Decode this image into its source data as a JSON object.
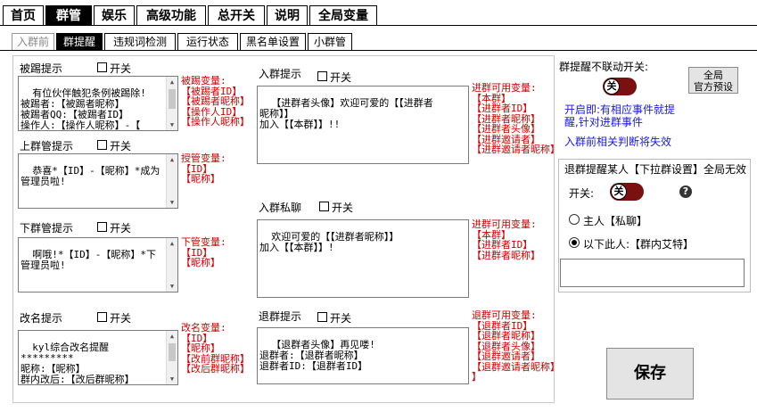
{
  "top_tabs": [
    "首页",
    "群管",
    "娱乐",
    "高级功能",
    "总开关",
    "说明",
    "全局变量"
  ],
  "sub_tabs": [
    "入群前",
    "群提醒",
    "违规词检测",
    "运行状态",
    "黑名单设置",
    "小群管"
  ],
  "checkbox_label": "开关",
  "kick": {
    "title": "被踢提示",
    "text": "有位伙伴触犯条例被踢除!\n被踢者:【被踢者昵称】\n被踢者QQ:【被踢者ID】\n操作人:【操作人昵称】-【\n操作人ID】",
    "vars": "被踢变量:\n【被踢者ID】\n【被踢者昵称】\n【操作人ID】\n【操作人昵称】"
  },
  "promote": {
    "title": "上群管提示",
    "text": "恭喜*【ID】-【昵称】*成为\n管理员啦!",
    "vars": "授管变量:\n【ID】\n【昵称】"
  },
  "demote": {
    "title": "下群管提示",
    "text": "啊哦!*【ID】-【昵称】*下\n管理员啦!",
    "vars": "下管变量:\n【ID】\n【昵称】"
  },
  "rename": {
    "title": "改名提示",
    "text": "kyl综合改名提醒\n*********\n昵称:【昵称】\n群内改后:【改后群昵称】\n群内改前:【改前群昵称】",
    "vars": "改名变量:\n【ID】\n【昵称】\n【改前群昵称】\n【改后群昵称】"
  },
  "join": {
    "title": "入群提示",
    "text": "【进群者头像】欢迎可爱的【【进群者\n昵称】】\n加入【【本群】】!!",
    "vars": "进群可用变量:\n【本群】\n【进群者ID】\n【进群者昵称】\n【进群者头像】\n【进群邀请者】\n【进群邀请者昵称】"
  },
  "join_private": {
    "title": "入群私聊",
    "text": "欢迎可爱的【【进群者昵称】】\n加入【【本群】】!",
    "vars": "进群可用变量:\n【本群】\n【进群者ID】\n【进群者昵称】"
  },
  "leave": {
    "title": "退群提示",
    "text": "【退群者头像】再见喽!\n退群者:【退群者昵称】\n退群者ID:【退群者ID】",
    "vars": "退群可用变量:\n【退群者ID】\n【退群者昵称】\n【退群者头像】\n【退群邀请者】\n【退群邀请者昵称】\n】"
  },
  "right": {
    "no_link_label": "群提醒不联动开关:",
    "toggle_text": "关",
    "preset_button": "全局\n官方预设",
    "desc1": "开启即:有相应事件就提\n醒,针对进群事件",
    "desc2": "入群前相关判断将失效",
    "group_title": "退群提醒某人【下拉群设置】全局无效",
    "switch_label": "开关:",
    "help_icon": "?",
    "radio1": "主人【私聊】",
    "radio2": "以下此人:【群内艾特】",
    "radio_selected": 2,
    "target_value": "",
    "save_button": "保存"
  }
}
